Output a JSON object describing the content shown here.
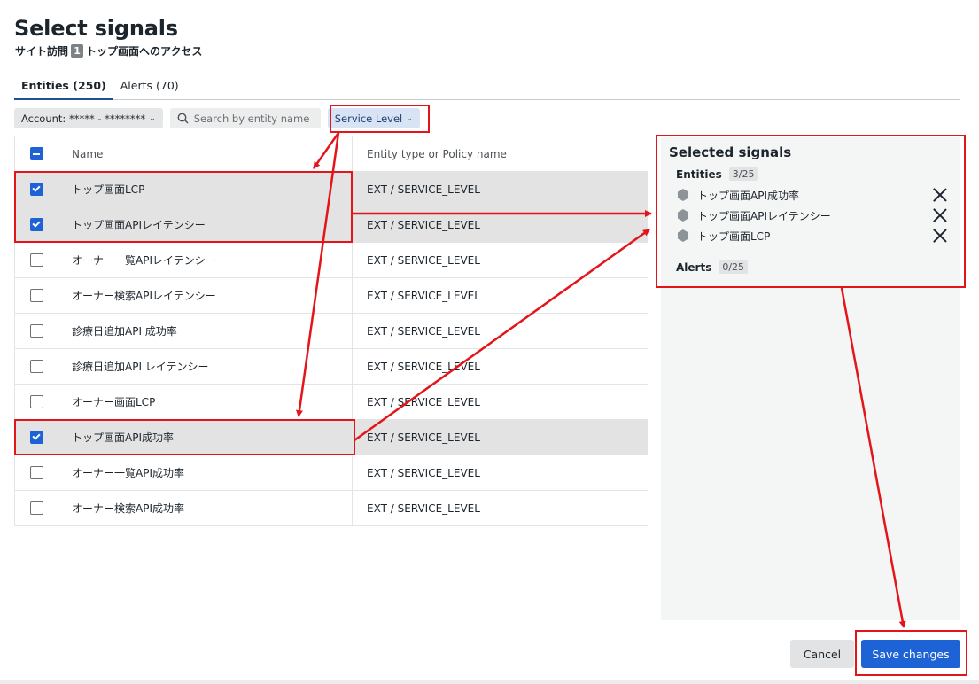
{
  "dialog": {
    "title": "Select signals",
    "subtitle_pre": "サイト訪問",
    "subtitle_num": "1",
    "subtitle_post": "トップ画面へのアクセス"
  },
  "tabs": [
    {
      "label": "Entities (250)",
      "active": true
    },
    {
      "label": "Alerts (70)",
      "active": false
    }
  ],
  "filters": {
    "account": "Account: ***** - ********",
    "search_placeholder": "Search by entity name",
    "service_level": "Service Level"
  },
  "table": {
    "headers": {
      "name": "Name",
      "type": "Entity type or Policy name"
    },
    "rows": [
      {
        "name": "トップ画面LCP",
        "type": "EXT / SERVICE_LEVEL",
        "checked": true
      },
      {
        "name": "トップ画面APIレイテンシー",
        "type": "EXT / SERVICE_LEVEL",
        "checked": true
      },
      {
        "name": "オーナー一覧APIレイテンシー",
        "type": "EXT / SERVICE_LEVEL",
        "checked": false
      },
      {
        "name": "オーナー検索APIレイテンシー",
        "type": "EXT / SERVICE_LEVEL",
        "checked": false
      },
      {
        "name": "診療日追加API 成功率",
        "type": "EXT / SERVICE_LEVEL",
        "checked": false
      },
      {
        "name": "診療日追加API レイテンシー",
        "type": "EXT / SERVICE_LEVEL",
        "checked": false
      },
      {
        "name": "オーナー画面LCP",
        "type": "EXT / SERVICE_LEVEL",
        "checked": false
      },
      {
        "name": "トップ画面API成功率",
        "type": "EXT / SERVICE_LEVEL",
        "checked": true
      },
      {
        "name": "オーナー一覧API成功率",
        "type": "EXT / SERVICE_LEVEL",
        "checked": false
      },
      {
        "name": "オーナー検索API成功率",
        "type": "EXT / SERVICE_LEVEL",
        "checked": false
      }
    ]
  },
  "selected": {
    "title": "Selected signals",
    "entities_label": "Entities",
    "entities_count": "3/25",
    "items": [
      "トップ画面API成功率",
      "トップ画面APIレイテンシー",
      "トップ画面LCP"
    ],
    "alerts_label": "Alerts",
    "alerts_count": "0/25"
  },
  "buttons": {
    "cancel": "Cancel",
    "save": "Save changes"
  },
  "colors": {
    "accent": "#1d63d6",
    "annotation": "#e4151a"
  }
}
